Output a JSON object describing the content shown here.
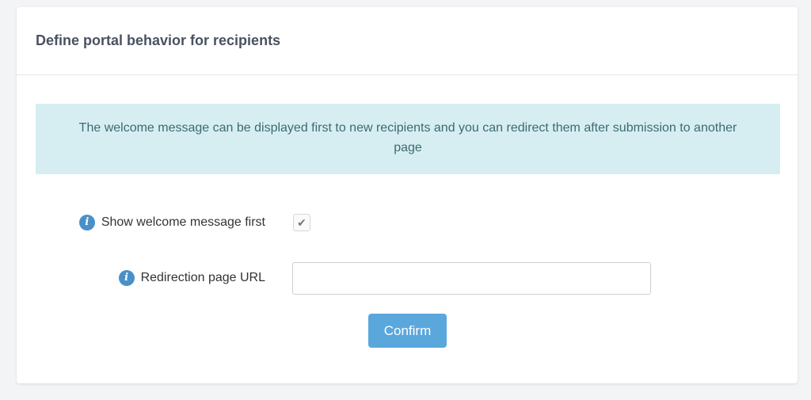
{
  "panel": {
    "title": "Define portal behavior for recipients",
    "info_text": "The welcome message can be displayed first to new recipients and you can redirect them after submission to another page"
  },
  "form": {
    "welcome": {
      "label": "Show welcome message first",
      "checked": true,
      "check_glyph": "✔",
      "icon": "info-icon"
    },
    "redirect": {
      "label": "Redirection page URL",
      "value": "",
      "icon": "info-icon"
    },
    "confirm_label": "Confirm"
  },
  "colors": {
    "accent": "#5aa7dc",
    "info_icon": "#4a90c8",
    "alert_bg": "#d6eef2",
    "alert_text": "#3c6a72"
  }
}
